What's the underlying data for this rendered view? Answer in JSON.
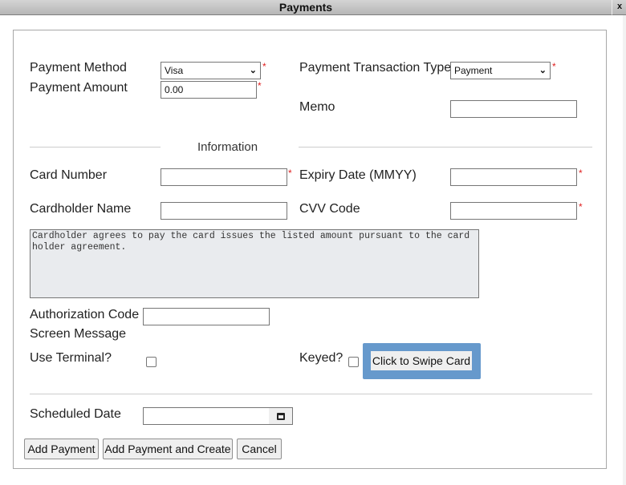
{
  "window": {
    "title": "Payments",
    "close_label": "x"
  },
  "form": {
    "payment_method": {
      "label": "Payment Method",
      "value": "Visa",
      "required_mark": "*"
    },
    "payment_amount": {
      "label": "Payment Amount",
      "value": "0.00",
      "required_mark": "*"
    },
    "transaction_type": {
      "label": "Payment Transaction Type",
      "value": "Payment",
      "required_mark": "*"
    },
    "memo": {
      "label": "Memo",
      "value": ""
    },
    "information_section": {
      "title": "Information"
    },
    "card_number": {
      "label": "Card Number",
      "value": "",
      "required_mark": "*"
    },
    "expiry_date": {
      "label": "Expiry Date (MMYY)",
      "value": "",
      "required_mark": "*"
    },
    "cardholder_name": {
      "label": "Cardholder Name",
      "value": ""
    },
    "cvv_code": {
      "label": "CVV Code",
      "value": "",
      "required_mark": "*"
    },
    "agreement_text": "Cardholder agrees to pay the card issues the listed amount pursuant to the card holder agreement.",
    "authorization_code": {
      "label": "Authorization Code",
      "value": ""
    },
    "screen_message": {
      "label": "Screen Message"
    },
    "use_terminal": {
      "label": "Use Terminal?",
      "checked": false
    },
    "keyed": {
      "label": "Keyed?",
      "checked": false
    },
    "swipe_button": "Click to Swipe Card",
    "scheduled_date": {
      "label": "Scheduled Date",
      "value": "",
      "calendar_icon": "calendar-icon"
    }
  },
  "actions": {
    "add_payment": "Add Payment",
    "add_payment_and_create": "Add Payment and Create",
    "cancel": "Cancel"
  },
  "colors": {
    "required": "#e02020",
    "swipe_highlight": "#6699cc",
    "agreement_bg": "#e9ebee"
  }
}
